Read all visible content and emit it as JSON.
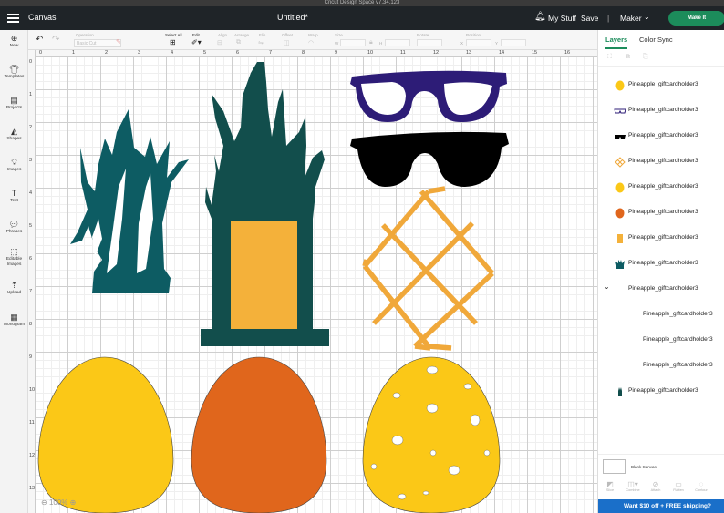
{
  "window": {
    "title": "Cricut Design Space  v7.34.123"
  },
  "header": {
    "app_section": "Canvas",
    "doc_title": "Untitled*",
    "my_stuff": "My Stuff",
    "save": "Save",
    "separator": "|",
    "machine": "Maker",
    "make_it": "Make It"
  },
  "toolbar": {
    "operation_label": "Operation",
    "operation_value": "Basic Cut",
    "select_all": "Select All",
    "edit": "Edit",
    "align": "Align",
    "arrange": "Arrange",
    "flip": "Flip",
    "offset": "Offset",
    "warp": "Warp",
    "size": "Size",
    "rotate": "Rotate",
    "position": "Position",
    "size_w": "W",
    "size_h": "H",
    "pos_x": "X",
    "pos_y": "Y"
  },
  "sidebar": [
    {
      "label": "New",
      "icon": "plus-icon"
    },
    {
      "label": "Templates",
      "icon": "shirt-icon"
    },
    {
      "label": "Projects",
      "icon": "projects-icon"
    },
    {
      "label": "Shapes",
      "icon": "shapes-icon"
    },
    {
      "label": "Images",
      "icon": "bulb-icon"
    },
    {
      "label": "Text",
      "icon": "text-icon"
    },
    {
      "label": "Phrases",
      "icon": "speech-icon"
    },
    {
      "label": "Editable Images",
      "icon": "editable-icon"
    },
    {
      "label": "Upload",
      "icon": "upload-icon"
    },
    {
      "label": "Monogram",
      "icon": "monogram-icon"
    }
  ],
  "canvas": {
    "ruler_h": [
      "0",
      "1",
      "2",
      "3",
      "4",
      "5",
      "6",
      "7",
      "8",
      "9",
      "10",
      "11",
      "12",
      "13",
      "14",
      "15",
      "16",
      "17"
    ],
    "ruler_v": [
      "0",
      "1",
      "2",
      "3",
      "4",
      "5",
      "6",
      "7",
      "8",
      "9",
      "10",
      "11",
      "12",
      "13",
      "14"
    ],
    "zoom": "100%",
    "colors": {
      "dark_teal": "#0d5c63",
      "pine_teal": "#124e4c",
      "yellow": "#fbc817",
      "light_orange": "#f4b13a",
      "orange": "#e0661c",
      "navy": "#2d1c77",
      "black": "#000000",
      "lattice": "#f0a83a"
    }
  },
  "panel": {
    "tab_layers": "Layers",
    "tab_sync": "Color Sync",
    "layers": [
      {
        "name": "Pineapple_giftcardholder3",
        "swatch": "yellow-oval",
        "color": "#fbc817"
      },
      {
        "name": "Pineapple_giftcardholder3",
        "swatch": "glasses",
        "color": "#2d1c77"
      },
      {
        "name": "Pineapple_giftcardholder3",
        "swatch": "sunglasses",
        "color": "#000000"
      },
      {
        "name": "Pineapple_giftcardholder3",
        "swatch": "lattice",
        "color": "#f0a83a"
      },
      {
        "name": "Pineapple_giftcardholder3",
        "swatch": "yellow-oval",
        "color": "#fbc817"
      },
      {
        "name": "Pineapple_giftcardholder3",
        "swatch": "orange-oval",
        "color": "#e0661c"
      },
      {
        "name": "Pineapple_giftcardholder3",
        "swatch": "rect",
        "color": "#f4b13a"
      },
      {
        "name": "Pineapple_giftcardholder3",
        "swatch": "leaves",
        "color": "#0d5c63"
      },
      {
        "name": "Pineapple_giftcardholder3",
        "swatch": "group",
        "color": ""
      },
      {
        "name": "Pineapple_giftcardholder3",
        "swatch": "none",
        "color": ""
      },
      {
        "name": "Pineapple_giftcardholder3",
        "swatch": "none",
        "color": ""
      },
      {
        "name": "Pineapple_giftcardholder3",
        "swatch": "none",
        "color": ""
      },
      {
        "name": "Pineapple_giftcardholder3",
        "swatch": "pine",
        "color": "#124e4c"
      }
    ],
    "blank_canvas": "Blank Canvas",
    "ops": [
      "Slice",
      "Combine",
      "Attach",
      "Flatten",
      "Contour"
    ],
    "promo": "Want $10 off + FREE shipping?"
  }
}
